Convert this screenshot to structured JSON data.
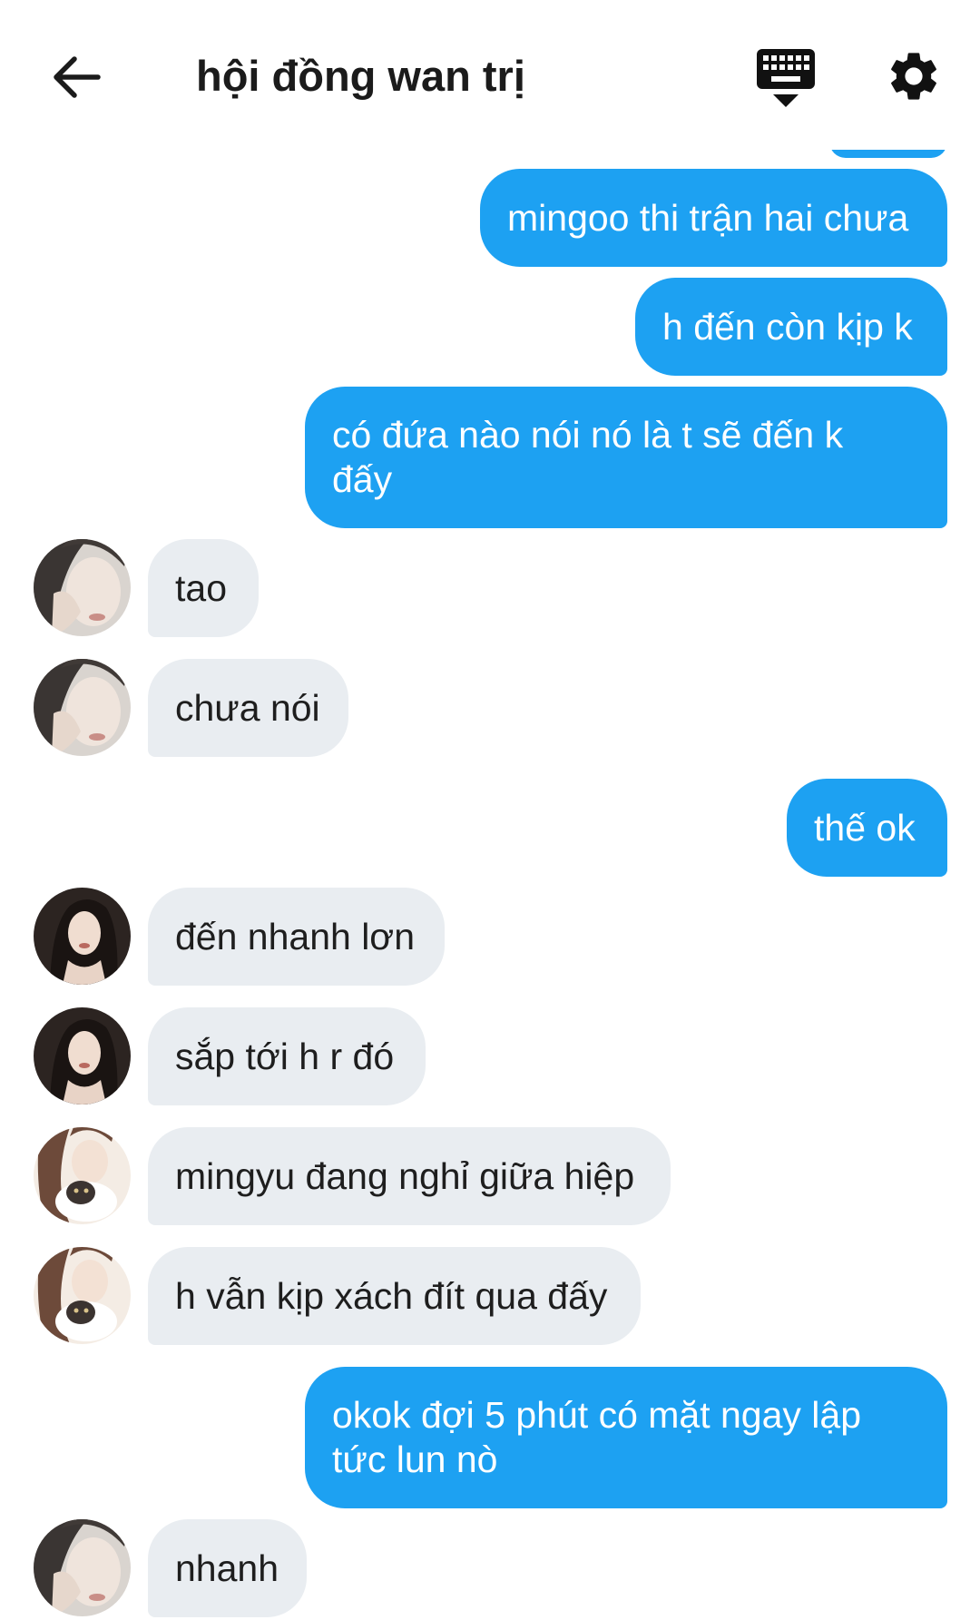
{
  "header": {
    "title": "hội đồng wan trị",
    "back_icon": "arrow-left-icon",
    "keyboard_icon": "keyboard-icon",
    "settings_icon": "gear-icon"
  },
  "colors": {
    "outgoing_bubble": "#1da1f2",
    "incoming_bubble": "#e9edf1"
  },
  "messages": [
    {
      "side": "out",
      "text": "mingoo thi trận hai chưa"
    },
    {
      "side": "out",
      "text": "h đến còn kịp k"
    },
    {
      "side": "out",
      "text": "có đứa nào nói nó là t sẽ đến k đấy"
    },
    {
      "side": "in",
      "text": "tao",
      "avatar": "avatar-a"
    },
    {
      "side": "in",
      "text": "chưa nói",
      "avatar": "avatar-a"
    },
    {
      "side": "out",
      "text": "thế ok"
    },
    {
      "side": "in",
      "text": "đến nhanh lơn",
      "avatar": "avatar-b"
    },
    {
      "side": "in",
      "text": "sắp tới h r đó",
      "avatar": "avatar-b"
    },
    {
      "side": "in",
      "text": "mingyu đang nghỉ giữa hiệp",
      "avatar": "avatar-c"
    },
    {
      "side": "in",
      "text": "h vẫn kịp xách đít qua đấy",
      "avatar": "avatar-c"
    },
    {
      "side": "out",
      "text": "okok đợi 5 phút có mặt ngay lập tức lun nò"
    },
    {
      "side": "in",
      "text": "nhanh",
      "avatar": "avatar-a"
    }
  ]
}
